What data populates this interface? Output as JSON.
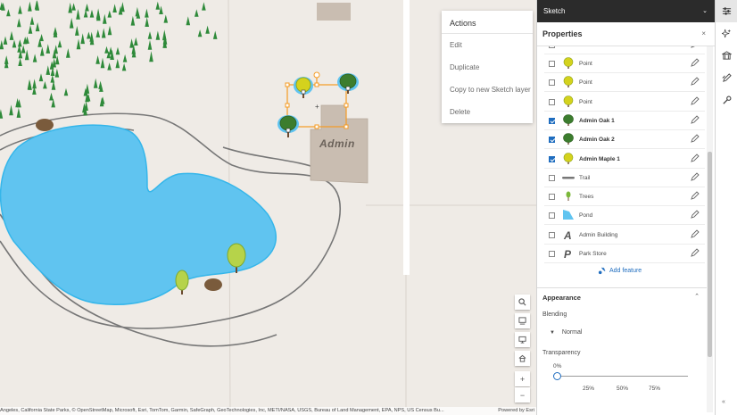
{
  "map": {
    "building_label": "Admin",
    "attribution": "Angeles, California State Parks, © OpenStreetMap, Microsoft, Esri, TomTom, Garmin, SafeGraph, GeoTechnologies, Inc, METI/NASA, USGS, Bureau of Land Management, EPA, NPS, US Census Bu...",
    "powered_by": "Powered by Esri",
    "controls": [
      "search-icon",
      "layers-icon",
      "screen-icon",
      "home-icon"
    ],
    "zoom_in": "+",
    "zoom_out": "−"
  },
  "actions_popup": {
    "title": "Actions",
    "items": [
      "Edit",
      "Duplicate",
      "Copy to new Sketch layer",
      "Delete"
    ]
  },
  "panel": {
    "title": "Sketch",
    "properties_title": "Properties",
    "close": "×",
    "features": [
      {
        "label": "Point",
        "checked": false,
        "bold": false,
        "icon": "maple-tree-icon"
      },
      {
        "label": "Point",
        "checked": false,
        "bold": false,
        "icon": "maple-tree-icon"
      },
      {
        "label": "Point",
        "checked": false,
        "bold": false,
        "icon": "maple-tree-icon"
      },
      {
        "label": "Admin Oak 1",
        "checked": true,
        "bold": true,
        "icon": "oak-tree-icon"
      },
      {
        "label": "Admin Oak 2",
        "checked": true,
        "bold": true,
        "icon": "oak-tree-icon"
      },
      {
        "label": "Admin Maple 1",
        "checked": true,
        "bold": true,
        "icon": "maple-tree-icon"
      },
      {
        "label": "Trail",
        "checked": false,
        "bold": false,
        "icon": "trail-line-icon"
      },
      {
        "label": "Trees",
        "checked": false,
        "bold": false,
        "icon": "small-tree-icon"
      },
      {
        "label": "Pond",
        "checked": false,
        "bold": false,
        "icon": "pond-polygon-icon"
      },
      {
        "label": "Admin Building",
        "checked": false,
        "bold": false,
        "icon": "letter-a-icon"
      },
      {
        "label": "Park Store",
        "checked": false,
        "bold": false,
        "icon": "letter-p-icon"
      }
    ],
    "add_feature": "Add feature",
    "appearance": {
      "title": "Appearance",
      "blending_label": "Blending",
      "blending_value": "Normal",
      "transparency_label": "Transparency",
      "transparency_value": "0%",
      "transparency_fraction": 0,
      "ticks": [
        "25%",
        "50%",
        "75%"
      ]
    }
  },
  "tool_strip": {
    "tools": [
      "sliders-icon",
      "sparkle-icon",
      "building-icon",
      "draw-icon",
      "wrench-icon"
    ],
    "collapse": "«"
  },
  "colors": {
    "water": "#60c4f0",
    "selection": "#f59b23",
    "accent": "#1f6dbf",
    "header": "#2b2b2b"
  }
}
